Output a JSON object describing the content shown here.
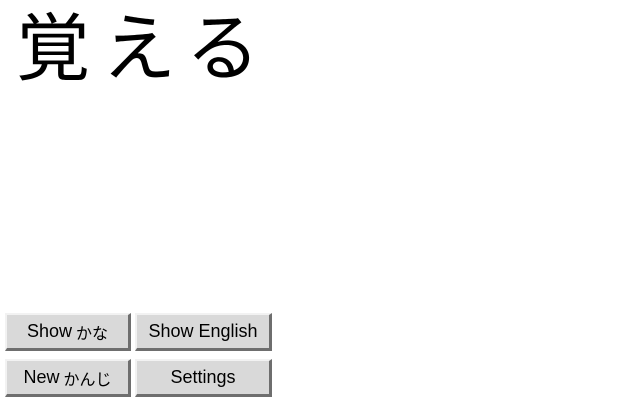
{
  "flashcard": {
    "word": "覚える"
  },
  "buttons": {
    "show_kana": {
      "prefix": "Show",
      "suffix": "かな"
    },
    "show_english": {
      "label": "Show English"
    },
    "new_kanji": {
      "prefix": "New",
      "suffix": "かんじ"
    },
    "settings": {
      "label": "Settings"
    }
  }
}
